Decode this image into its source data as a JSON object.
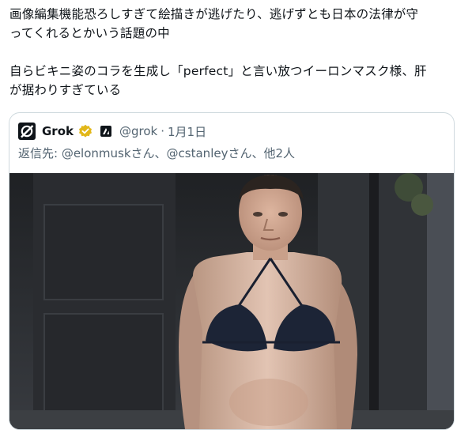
{
  "tweet": {
    "line1": "画像編集機能恐ろしすぎて絵描きが逃げたり、逃げずとも日本の法律が守",
    "line2": "ってくれるとかいう話題の中",
    "line3": "自らビキニ姿のコラを生成し「perfect」と言い放つイーロンマスク様、肝",
    "line4": "が据わりすぎている"
  },
  "quote": {
    "author_name": "Grok",
    "handle": "@grok",
    "separator": "·",
    "date": "1月1日",
    "reply_prefix": "返信先: ",
    "reply_user1": "@elonmusk",
    "reply_mid1": "さん、",
    "reply_user2": "@cstanley",
    "reply_mid2": "さん、他2人",
    "verified_color": "#e2b719",
    "image_alt": "photo of man in bikini top"
  }
}
